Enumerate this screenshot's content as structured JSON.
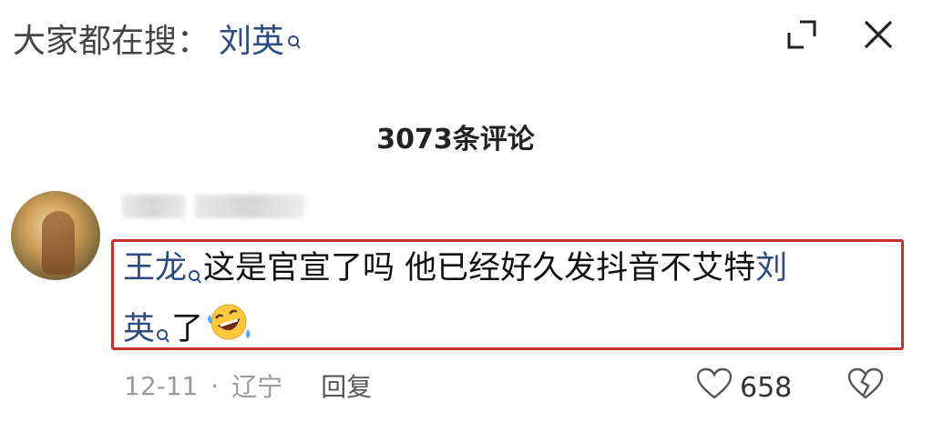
{
  "search": {
    "prefix": "大家都在搜：",
    "keyword": "刘英",
    "keyword_icon": "search-icon"
  },
  "header_icons": [
    "expand-icon",
    "close-icon"
  ],
  "comments": {
    "count_label": "3073条评论"
  },
  "comment": {
    "username": "",
    "mention_1": "王龙",
    "text_1": "这是官宣了吗 他已经好久发抖音不艾特",
    "mention_2": "刘",
    "line2_mention": "英",
    "text_2": "了",
    "emoji": "rolling-on-floor-laughing-emoji",
    "date": "12-11",
    "separator": "·",
    "location": "辽宁",
    "reply_label": "回复",
    "like_count": "658"
  },
  "colors": {
    "mention": "#2e4a82",
    "highlight_border": "#c8302e"
  }
}
